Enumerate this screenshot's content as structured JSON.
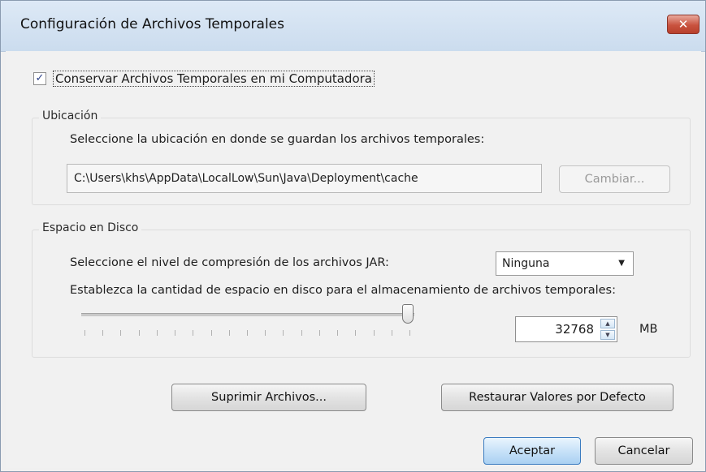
{
  "dialog": {
    "title": "Configuración de Archivos Temporales",
    "close_label": "✕"
  },
  "keep_files": {
    "checked": true,
    "check_glyph": "✓",
    "label": "Conservar Archivos Temporales en mi Computadora"
  },
  "location": {
    "group_title": "Ubicación",
    "instruction": "Seleccione la ubicación en donde se guardan los archivos temporales:",
    "path_value": "C:\\Users\\khs\\AppData\\LocalLow\\Sun\\Java\\Deployment\\cache",
    "change_button": "Cambiar..."
  },
  "disk_space": {
    "group_title": "Espacio en Disco",
    "compression_label": "Seleccione el nivel de compresión de los archivos JAR:",
    "compression_value": "Ninguna",
    "amount_label": "Establezca la cantidad de espacio en disco para el almacenamiento de archivos temporales:",
    "slider_level": 0.98,
    "amount_value": "32768",
    "unit": "MB"
  },
  "actions": {
    "delete_files": "Suprimir Archivos...",
    "restore_defaults": "Restaurar Valores por Defecto"
  },
  "footer": {
    "ok": "Aceptar",
    "cancel": "Cancelar"
  },
  "icons": {
    "close": "close-icon",
    "dropdown": "chevron-down-icon",
    "spin_up": "up-arrow-icon",
    "spin_down": "down-arrow-icon"
  }
}
